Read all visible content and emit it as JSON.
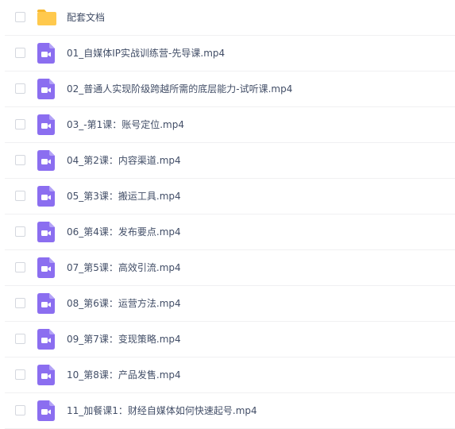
{
  "files": [
    {
      "name": "配套文档",
      "type": "folder",
      "icon": "folder-icon"
    },
    {
      "name": "01_自媒体IP实战训练营-先导课.mp4",
      "type": "video",
      "icon": "video-file-icon"
    },
    {
      "name": "02_普通人实现阶级跨越所需的底层能力-试听课.mp4",
      "type": "video",
      "icon": "video-file-icon"
    },
    {
      "name": "03_-第1课：账号定位.mp4",
      "type": "video",
      "icon": "video-file-icon"
    },
    {
      "name": "04_第2课：内容渠道.mp4",
      "type": "video",
      "icon": "video-file-icon"
    },
    {
      "name": "05_第3课：搬运工具.mp4",
      "type": "video",
      "icon": "video-file-icon"
    },
    {
      "name": "06_第4课：发布要点.mp4",
      "type": "video",
      "icon": "video-file-icon"
    },
    {
      "name": "07_第5课：高效引流.mp4",
      "type": "video",
      "icon": "video-file-icon"
    },
    {
      "name": "08_第6课：运营方法.mp4",
      "type": "video",
      "icon": "video-file-icon"
    },
    {
      "name": "09_第7课：变现策略.mp4",
      "type": "video",
      "icon": "video-file-icon"
    },
    {
      "name": "10_第8课：产品发售.mp4",
      "type": "video",
      "icon": "video-file-icon"
    },
    {
      "name": "11_加餐课1：财经自媒体如何快速起号.mp4",
      "type": "video",
      "icon": "video-file-icon"
    }
  ],
  "colors": {
    "folder": "#ffc94d",
    "folder_tab": "#f7b82e",
    "video": "#8b6ef0",
    "text": "#424e67",
    "divider": "#f0f0f2"
  }
}
